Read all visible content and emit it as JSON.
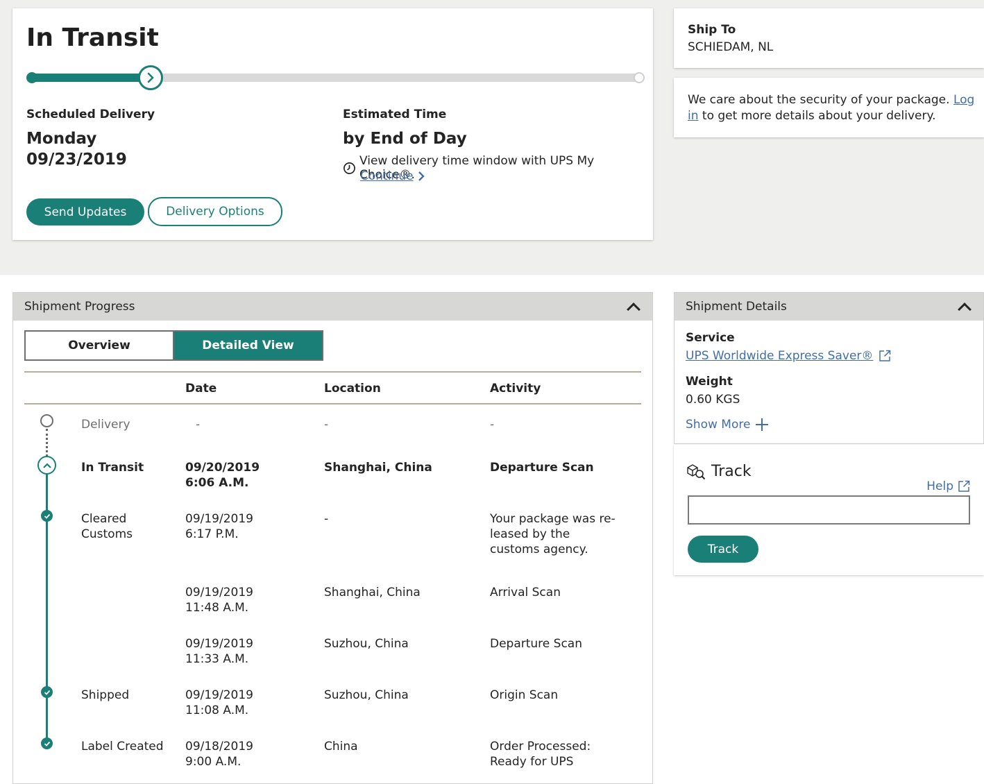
{
  "status": {
    "title": "In Transit",
    "progress_fraction": 0.195,
    "scheduled_label": "Scheduled Delivery",
    "scheduled_day": "Monday",
    "scheduled_date": "09/23/2019",
    "estimated_label": "Estimated Time",
    "estimated_value": "by End of Day",
    "estimated_note": "View delivery time window with UPS My Choice®.",
    "continue_label": "Continue",
    "send_updates_label": "Send Updates",
    "delivery_options_label": "Delivery Options"
  },
  "ship_to": {
    "label": "Ship To",
    "value": "SCHIEDAM, NL"
  },
  "security": {
    "text_before": "We care about the security of your package.",
    "login_label": "Log in",
    "text_after": "to get more details about your delivery."
  },
  "shipment_progress": {
    "header": "Shipment Progress",
    "tab_overview": "Overview",
    "tab_detailed": "Detailed View",
    "columns": {
      "date": "Date",
      "location": "Location",
      "activity": "Activity"
    },
    "rows": [
      {
        "status": "Delivery",
        "date": "-",
        "time": "",
        "location": "-",
        "activity": "-"
      },
      {
        "status": "In Transit",
        "date": "09/20/2019",
        "time": "6:06 A.M.",
        "location": "Shanghai, China",
        "activity": "Departure Scan"
      },
      {
        "status": "Cleared Customs",
        "date": "09/19/2019",
        "time": "6:17 P.M.",
        "location": "-",
        "activity": "Your package was re­leased by the customs agency."
      },
      {
        "status": "",
        "date": "09/19/2019",
        "time": "11:48 A.M.",
        "location": "Shanghai, China",
        "activity": "Arrival Scan"
      },
      {
        "status": "",
        "date": "09/19/2019",
        "time": "11:33 A.M.",
        "location": "Suzhou, China",
        "activity": "Departure Scan"
      },
      {
        "status": "Shipped",
        "date": "09/19/2019",
        "time": "11:08 A.M.",
        "location": "Suzhou, China",
        "activity": "Origin Scan"
      },
      {
        "status": "Label Created",
        "date": "09/18/2019",
        "time": "9:00 A.M.",
        "location": "China",
        "activity": "Order Processed: Ready for UPS"
      }
    ]
  },
  "shipment_details": {
    "header": "Shipment Details",
    "service_label": "Service",
    "service_value": "UPS Worldwide Express Saver®",
    "weight_label": "Weight",
    "weight_value": "0.60 KGS",
    "show_more_label": "Show More"
  },
  "track": {
    "title": "Track",
    "help_label": "Help",
    "input_value": "",
    "button_label": "Track"
  },
  "colors": {
    "accent": "#1a7f77",
    "link": "#426da9",
    "header_bg": "#d7d7d5"
  }
}
